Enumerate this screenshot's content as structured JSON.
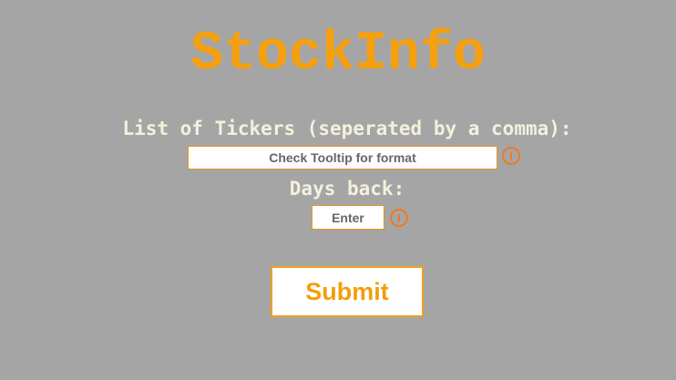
{
  "app": {
    "title": "StockInfo"
  },
  "form": {
    "tickers_label": "List of Tickers (seperated by a comma):",
    "tickers_placeholder": "Check Tooltip for format",
    "days_label": "Days back:",
    "days_placeholder": "Enter",
    "submit_label": "Submit"
  },
  "icons": {
    "tickers_info": "info-icon",
    "days_info": "info-icon"
  },
  "colors": {
    "background": "#a5a5a5",
    "accent": "#f5a00f",
    "label_text": "#f4f0dd",
    "info_icon": "#ef7a22"
  }
}
